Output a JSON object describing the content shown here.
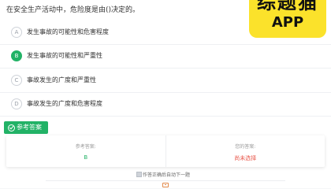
{
  "question": {
    "text": "在安全生产活动中，危险度是由()决定的。"
  },
  "watermark": {
    "title": "综题猫",
    "subtitle": "APP",
    "color": "#fbe22b"
  },
  "options": [
    {
      "letter": "A",
      "text": "发生事故的可能性和危害程度",
      "correct": false
    },
    {
      "letter": "B",
      "text": "发生事故的可能性和严重性",
      "correct": true
    },
    {
      "letter": "C",
      "text": "事故发生的广度和严重性",
      "correct": false
    },
    {
      "letter": "D",
      "text": "事故发生的广度和危害程度",
      "correct": false
    }
  ],
  "reference_button": {
    "label": "参考答案",
    "icon": "check-circle-icon"
  },
  "answer_card": {
    "reference_label": "参考答案:",
    "reference_value": "B",
    "your_label": "您的答案:",
    "your_value": "尚未选择"
  },
  "auto_next": {
    "label": "作答正确后自动下一题"
  },
  "bottom_bar": {
    "icon": "card-icon"
  },
  "colors": {
    "accent_green": "#22b266",
    "not_selected_red": "#e8564a"
  }
}
